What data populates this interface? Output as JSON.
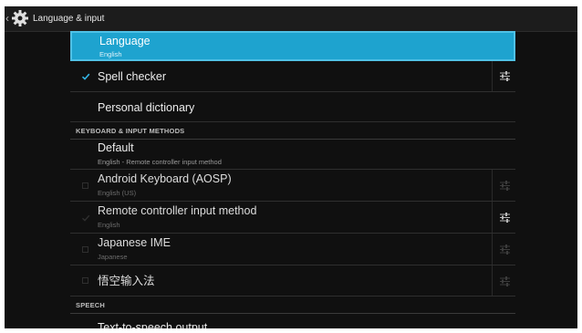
{
  "action_bar": {
    "title": "Language & input",
    "back_glyph": "‹",
    "icon": "gear-icon"
  },
  "rows": {
    "language": {
      "title": "Language",
      "summary": "English",
      "selected": true
    },
    "spell_checker": {
      "title": "Spell checker",
      "checked": true,
      "settings_icon": "tune-icon"
    },
    "personal_dictionary": {
      "title": "Personal dictionary"
    }
  },
  "keyboard_section": {
    "header": "KEYBOARD & INPUT METHODS",
    "default": {
      "title": "Default",
      "summary": "English - Remote controller input method"
    },
    "methods": [
      {
        "title": "Android Keyboard (AOSP)",
        "summary": "English (US)",
        "checked": false,
        "enabled": false
      },
      {
        "title": "Remote controller input method",
        "summary": "English",
        "checked": true,
        "enabled": false
      },
      {
        "title": "Japanese IME",
        "summary": "Japanese",
        "checked": false,
        "enabled": false
      },
      {
        "title": "悟空输入法",
        "summary": "",
        "checked": false,
        "enabled": false
      }
    ]
  },
  "speech_section": {
    "header": "SPEECH",
    "tts": {
      "title": "Text-to-speech output"
    }
  },
  "colors": {
    "accent": "#1ea3cf",
    "background": "#101010",
    "action_bar": "#1c1c1c"
  }
}
